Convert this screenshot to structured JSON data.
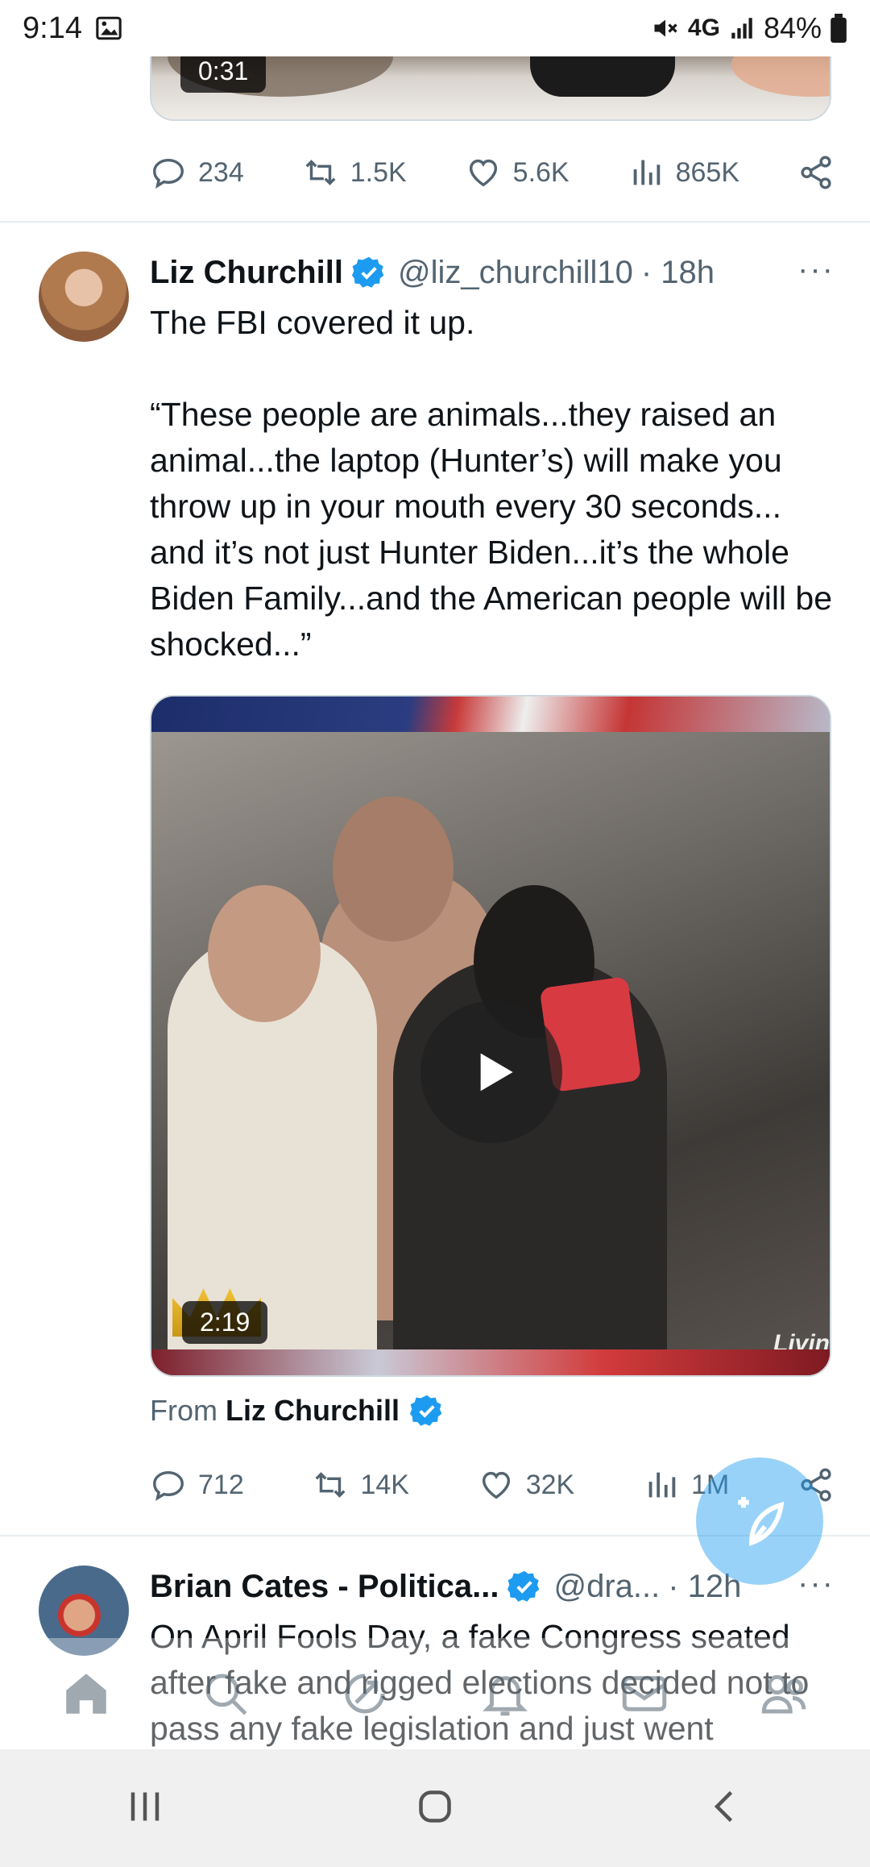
{
  "status_bar": {
    "time": "9:14",
    "network": "4G",
    "battery": "84%"
  },
  "previous_tweet": {
    "video_duration": "0:31",
    "actions": {
      "replies": "234",
      "retweets": "1.5K",
      "likes": "5.6K",
      "views": "865K"
    }
  },
  "tweet": {
    "author_name": "Liz Churchill",
    "handle": "@liz_churchill10",
    "time": "· 18h",
    "more": "···",
    "text_line1": "The FBI covered it up.",
    "text_quote": "“These people are animals...they raised an animal...the laptop (Hunter’s) will make you throw up in your mouth every 30 seconds... and it’s not just Hunter Biden...it’s the whole Biden Family...and the American people will be shocked...”",
    "video_duration": "2:19",
    "video_watermark": "Livin",
    "from_label": "From",
    "from_name": "Liz Churchill",
    "actions": {
      "replies": "712",
      "retweets": "14K",
      "likes": "32K",
      "views": "1M"
    }
  },
  "next_tweet": {
    "author_name": "Brian Cates - Politica...",
    "handle": "@dra...",
    "time": "· 12h",
    "more": "···",
    "text": "On April Fools Day, a fake Congress seated after fake and rigged elections decided not to pass any fake legislation and just went"
  },
  "colors": {
    "accent": "#1d9bf0",
    "muted": "#536471",
    "text": "#0f1419"
  },
  "icons": {
    "tabs": [
      "home-icon",
      "search-icon",
      "spaces-icon",
      "notifications-icon",
      "messages-icon",
      "communities-icon"
    ],
    "fab": "compose-icon"
  }
}
